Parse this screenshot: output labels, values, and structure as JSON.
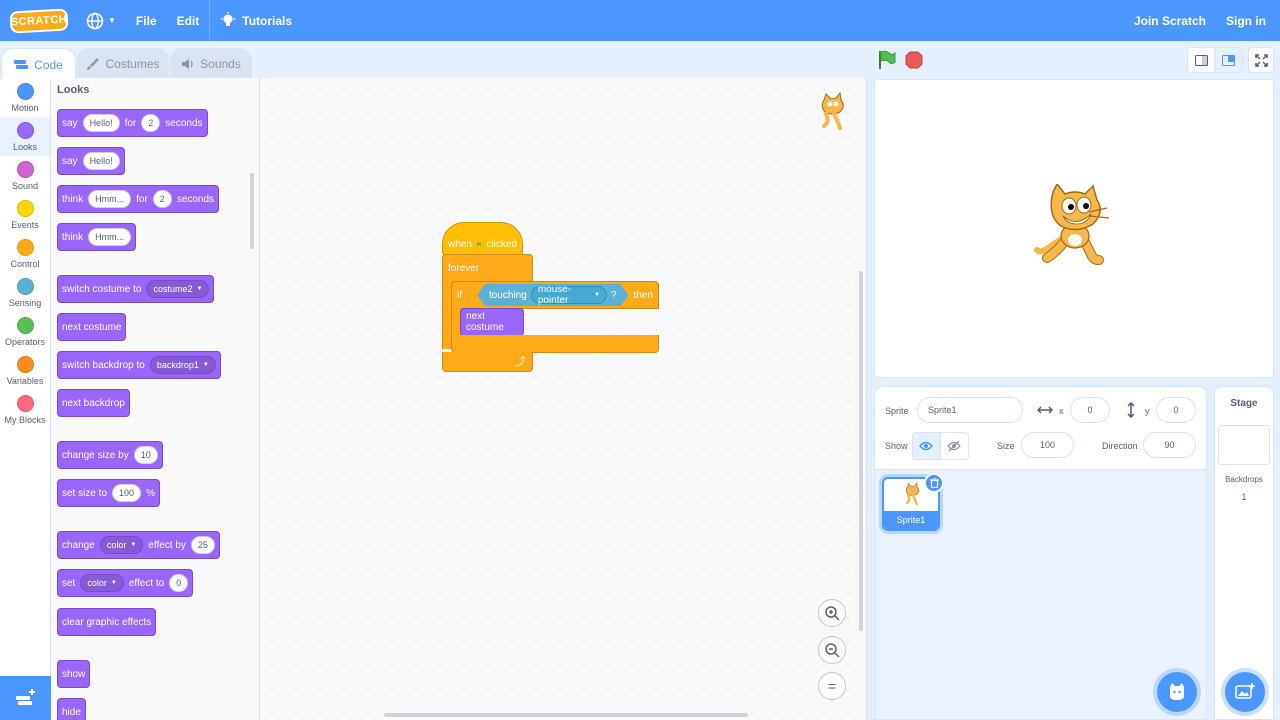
{
  "menu": {
    "logo": "SCRATCH",
    "file": "File",
    "edit": "Edit",
    "tutorials": "Tutorials",
    "join": "Join Scratch",
    "signin": "Sign in"
  },
  "tabs": {
    "code": "Code",
    "costumes": "Costumes",
    "sounds": "Sounds"
  },
  "categories": [
    {
      "label": "Motion",
      "color": "#4c97ff"
    },
    {
      "label": "Looks",
      "color": "#9966ff"
    },
    {
      "label": "Sound",
      "color": "#cf63cf"
    },
    {
      "label": "Events",
      "color": "#ffd500"
    },
    {
      "label": "Control",
      "color": "#ffab19"
    },
    {
      "label": "Sensing",
      "color": "#5cb1d6"
    },
    {
      "label": "Operators",
      "color": "#59c059"
    },
    {
      "label": "Variables",
      "color": "#ff8c1a"
    },
    {
      "label": "My Blocks",
      "color": "#ff6680"
    }
  ],
  "palette": {
    "title": "Looks",
    "say_for": {
      "say": "say",
      "msg": "Hello!",
      "for": "for",
      "secs": "2",
      "seconds": "seconds"
    },
    "say": {
      "say": "say",
      "msg": "Hello!"
    },
    "think_for": {
      "think": "think",
      "msg": "Hmm...",
      "for": "for",
      "secs": "2",
      "seconds": "seconds"
    },
    "think": {
      "think": "think",
      "msg": "Hmm..."
    },
    "switch_costume": {
      "label": "switch costume to",
      "value": "costume2"
    },
    "next_costume": "next costume",
    "switch_backdrop": {
      "label": "switch backdrop to",
      "value": "backdrop1"
    },
    "next_backdrop": "next backdrop",
    "change_size": {
      "label": "change size by",
      "value": "10"
    },
    "set_size": {
      "label": "set size to",
      "value": "100",
      "unit": "%"
    },
    "change_effect": {
      "change": "change",
      "effect": "color",
      "by": "effect by",
      "value": "25"
    },
    "set_effect": {
      "set": "set",
      "effect": "color",
      "to": "effect to",
      "value": "0"
    },
    "clear_effects": "clear graphic effects",
    "show": "show",
    "hide": "hide"
  },
  "script": {
    "when": "when",
    "clicked": "clicked",
    "forever": "forever",
    "if": "if",
    "touching": "touching",
    "target": "mouse-pointer",
    "q": "?",
    "then": "then",
    "next_costume": "next costume"
  },
  "sprite_info": {
    "sprite_label": "Sprite",
    "sprite_name": "Sprite1",
    "x_label": "x",
    "x": "0",
    "y_label": "y",
    "y": "0",
    "show_label": "Show",
    "size_label": "Size",
    "size": "100",
    "direction_label": "Direction",
    "direction": "90"
  },
  "sprite_list": [
    {
      "name": "Sprite1"
    }
  ],
  "stage_pane": {
    "title": "Stage",
    "backdrops_label": "Backdrops",
    "backdrops_count": "1"
  }
}
